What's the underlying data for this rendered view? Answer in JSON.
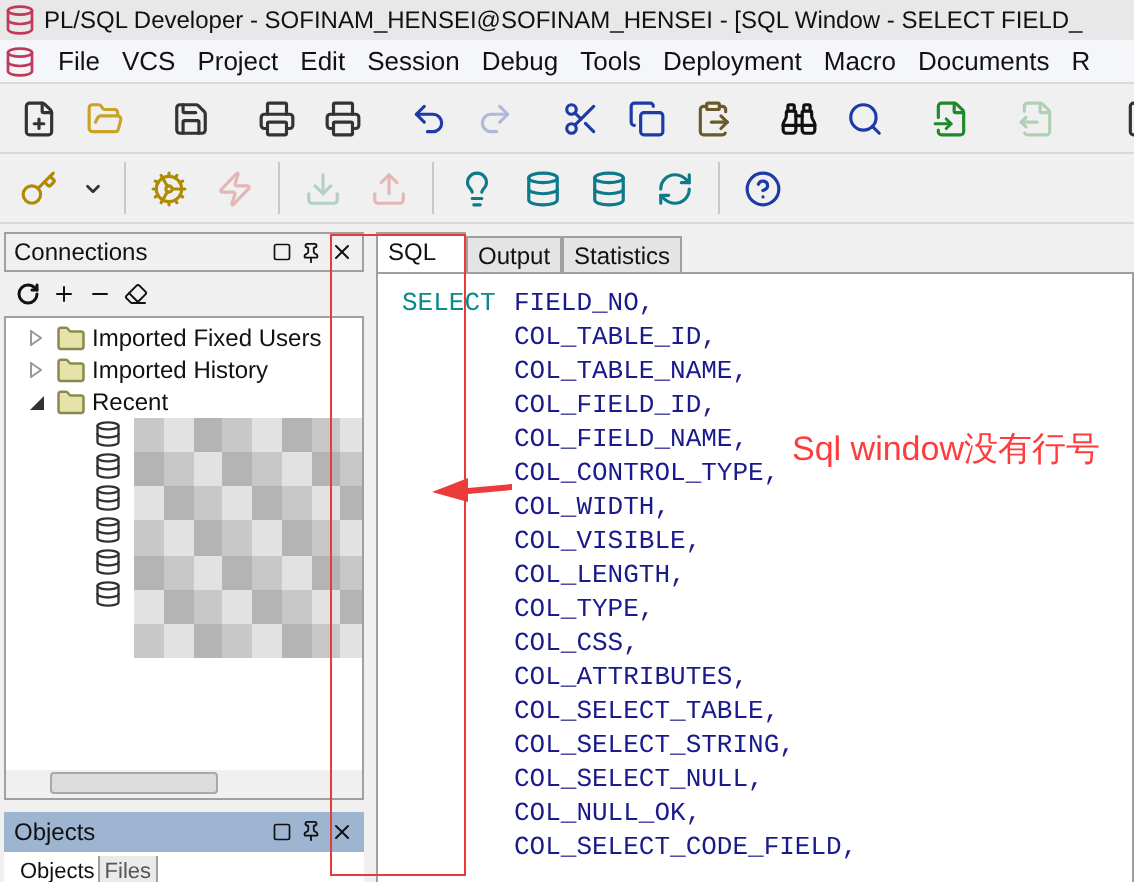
{
  "window": {
    "title": "PL/SQL Developer - SOFINAM_HENSEI@SOFINAM_HENSEI - [SQL Window - SELECT FIELD_"
  },
  "menu": [
    "File",
    "VCS",
    "Project",
    "Edit",
    "Session",
    "Debug",
    "Tools",
    "Deployment",
    "Macro",
    "Documents",
    "R"
  ],
  "toolbar_1": [
    {
      "disabled": false
    },
    {
      "disabled": false
    },
    {
      "disabled": false
    },
    {
      "disabled": false
    },
    {
      "disabled": false
    },
    {
      "disabled": false
    },
    {
      "disabled": true
    },
    {
      "disabled": false
    },
    {
      "disabled": false
    },
    {
      "disabled": false
    },
    {
      "disabled": false
    },
    {
      "disabled": false
    },
    {
      "disabled": false
    },
    {
      "disabled": true
    },
    {
      "disabled": false
    }
  ],
  "toolbar_2": [
    {
      "disabled": false
    },
    {
      "disabled": false
    },
    {
      "disabled": true
    },
    {
      "disabled": true
    },
    {
      "disabled": true
    },
    {
      "disabled": false
    },
    {
      "disabled": false
    },
    {
      "disabled": false
    },
    {
      "disabled": false
    },
    {
      "disabled": false
    }
  ],
  "connections": {
    "title": "Connections",
    "tree": [
      {
        "label": "Imported Fixed Users",
        "expanded": false
      },
      {
        "label": "Imported History",
        "expanded": false
      },
      {
        "label": "Recent",
        "expanded": true,
        "children": [
          {
            "kind": "database"
          },
          {
            "kind": "database"
          },
          {
            "kind": "database"
          },
          {
            "kind": "database"
          },
          {
            "kind": "database"
          },
          {
            "kind": "database"
          }
        ]
      }
    ]
  },
  "objects": {
    "title": "Objects",
    "tabs": [
      {
        "label": "Objects",
        "selected": true
      },
      {
        "label": "Files",
        "selected": false
      }
    ]
  },
  "editor_tabs": [
    {
      "label": "SQL",
      "selected": true
    },
    {
      "label": "Output",
      "selected": false
    },
    {
      "label": "Statistics",
      "selected": false
    }
  ],
  "sql_lines": [
    {
      "keyword": "SELECT",
      "text": "FIELD_NO,"
    },
    {
      "text": "COL_TABLE_ID,"
    },
    {
      "text": "COL_TABLE_NAME,"
    },
    {
      "text": "COL_FIELD_ID,"
    },
    {
      "text": "COL_FIELD_NAME,"
    },
    {
      "text": "COL_CONTROL_TYPE,"
    },
    {
      "text": "COL_WIDTH,"
    },
    {
      "text": "COL_VISIBLE,"
    },
    {
      "text": "COL_LENGTH,"
    },
    {
      "text": "COL_TYPE,"
    },
    {
      "text": "COL_CSS,"
    },
    {
      "text": "COL_ATTRIBUTES,"
    },
    {
      "text": "COL_SELECT_TABLE,"
    },
    {
      "text": "COL_SELECT_STRING,"
    },
    {
      "text": "COL_SELECT_NULL,"
    },
    {
      "text": "COL_NULL_OK,"
    },
    {
      "text": "COL_SELECT_CODE_FIELD,"
    }
  ],
  "annotation": {
    "text": "Sql window没有行号"
  }
}
